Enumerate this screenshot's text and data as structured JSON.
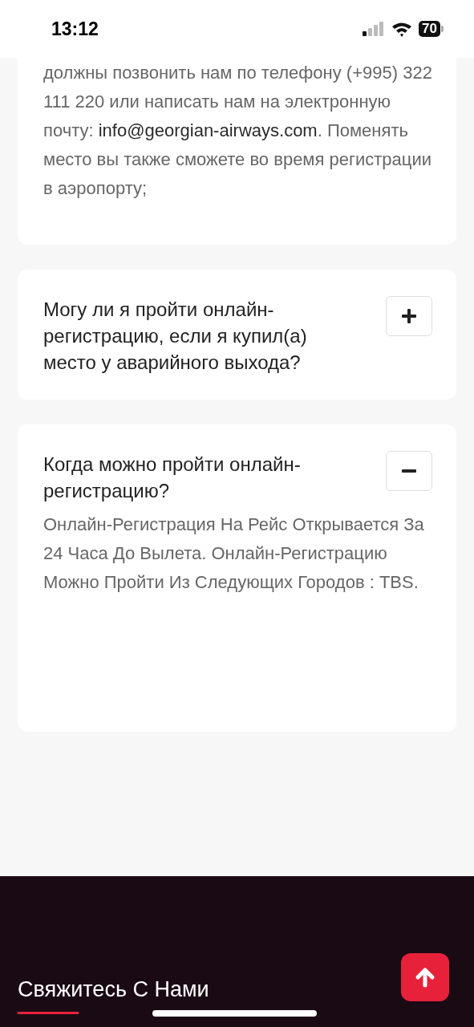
{
  "status_bar": {
    "time": "13:12",
    "battery": "70"
  },
  "partial_card": {
    "answer": [
      {
        "kind": "text",
        "text": "должны позвонить нам по телефону (+995) 322 111 220 или написать нам на электронную почту: "
      },
      {
        "kind": "link",
        "text": "info@georgian-airways.com"
      },
      {
        "kind": "text",
        "text": ". Поменять место вы также сможете во время регистрации в аэропорту;"
      }
    ]
  },
  "faq": [
    {
      "question": "Могу ли я пройти онлайн-регистрацию, если я купил(а) место у аварийного выхода?",
      "expanded": false
    },
    {
      "question": "Когда можно пройти онлайн-регистрацию?",
      "expanded": true,
      "answer": [
        {
          "kind": "text",
          "text": "Онлайн-Регистрация На Рейс Открывается За 24 Часа До Вылета. Онлайн-Регистрацию Можно Пройти Из Следующих Городов : TBS."
        }
      ]
    }
  ],
  "footer": {
    "heading": "Свяжитесь С Нами"
  }
}
